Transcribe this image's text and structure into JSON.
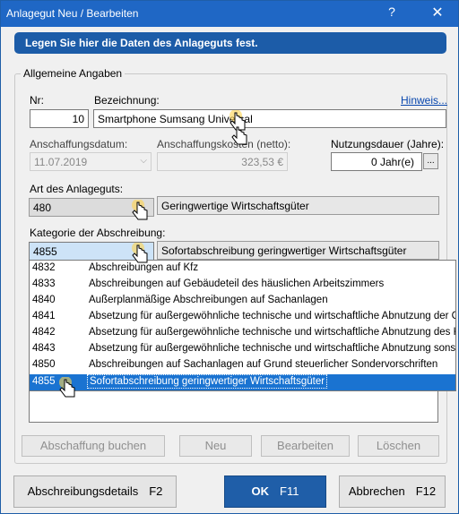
{
  "window": {
    "title": "Anlagegut Neu / Bearbeiten",
    "help_label": "?",
    "close_label": "✕"
  },
  "banner": {
    "text": "Legen Sie hier die Daten des Anlageguts fest."
  },
  "group": {
    "legend": "Allgemeine Angaben"
  },
  "fields": {
    "nr": {
      "label": "Nr:",
      "value": "10"
    },
    "bezeichnung": {
      "label": "Bezeichnung:",
      "value": "Smartphone Sumsang Universal"
    },
    "hinweis_link": "Hinweis...",
    "anschaffungsdatum": {
      "label": "Anschaffungsdatum:",
      "value": "11.07.2019"
    },
    "anschaffungskosten": {
      "label": "Anschaffungskosten (netto):",
      "value": "323,53 €"
    },
    "nutzungsdauer": {
      "label": "Nutzungsdauer (Jahre):",
      "value": "0 Jahr(e)",
      "button": "..."
    },
    "art": {
      "label": "Art des Anlageguts:",
      "code": "480",
      "desc": "Geringwertige Wirtschaftsgüter"
    },
    "kategorie": {
      "label": "Kategorie der Abschreibung:",
      "code": "4855",
      "desc": "Sofortabschreibung geringwertiger Wirtschaftsgüter"
    }
  },
  "category_list": [
    {
      "code": "4832",
      "desc": "Abschreibungen auf Kfz"
    },
    {
      "code": "4833",
      "desc": "Abschreibungen auf Gebäudeteil des häuslichen Arbeitszimmers"
    },
    {
      "code": "4840",
      "desc": "Außerplanmäßige Abschreibungen auf Sachanlagen"
    },
    {
      "code": "4841",
      "desc": "Absetzung für außergewöhnliche technische und wirtschaftliche Abnutzung der Gebäude"
    },
    {
      "code": "4842",
      "desc": "Absetzung für außergewöhnliche technische und wirtschaftliche Abnutzung des Kfz"
    },
    {
      "code": "4843",
      "desc": "Absetzung für außergewöhnliche technische und wirtschaftliche Abnutzung sonstiger WG"
    },
    {
      "code": "4850",
      "desc": "Abschreibungen auf Sachanlagen auf Grund steuerlicher Sondervorschriften"
    },
    {
      "code": "4855",
      "desc": "Sofortabschreibung geringwertiger Wirtschaftsgüter"
    }
  ],
  "inner_buttons": {
    "abschaffung": "Abschaffung buchen",
    "neu": "Neu",
    "bearbeiten": "Bearbeiten",
    "loeschen": "Löschen"
  },
  "footer": {
    "details": {
      "label": "Abschreibungsdetails",
      "key": "F2"
    },
    "ok": {
      "label": "OK",
      "key": "F11"
    },
    "cancel": {
      "label": "Abbrechen",
      "key": "F12"
    }
  }
}
